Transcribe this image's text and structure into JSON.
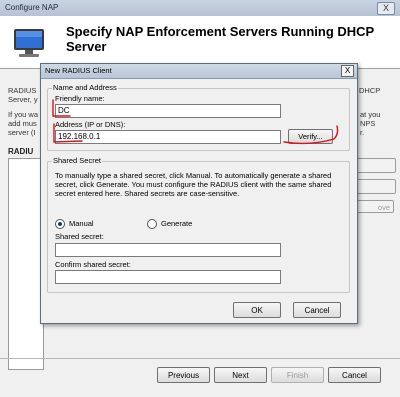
{
  "outer_window": {
    "title": "Configure NAP",
    "close_glyph": "X",
    "heading": "Specify NAP Enforcement Servers Running DHCP Server",
    "icon": "computer-monitor-icon",
    "bg_fragments": {
      "left_1": "RADIUS",
      "left_2": "Server, y",
      "right_1": "DHCP",
      "left_3": "If you wa",
      "left_4": "add mus",
      "left_5": "server (I",
      "right_2": "at you",
      "right_3": "NPS",
      "right_4": "r.",
      "list_heading": "RADIU",
      "side_btn_2": "",
      "side_btn_3": "ove"
    },
    "buttons": {
      "previous": "Previous",
      "next": "Next",
      "finish": "Finish",
      "cancel": "Cancel"
    }
  },
  "dialog": {
    "title": "New RADIUS Client",
    "close_glyph": "X",
    "name_group": {
      "label": "Name and Address",
      "friendly_name_label": "Friendly name:",
      "friendly_name_value": "DC",
      "address_label": "Address (IP or DNS):",
      "address_value": "192.168.0.1",
      "verify_label": "Verify..."
    },
    "secret_group": {
      "label": "Shared Secret",
      "description": "To manually type a shared secret, click Manual. To automatically generate a shared secret, click Generate. You must configure the RADIUS client with the same shared secret entered here. Shared secrets are case-sensitive.",
      "manual_label": "Manual",
      "generate_label": "Generate",
      "selected": "Manual",
      "shared_secret_label": "Shared secret:",
      "shared_secret_value": "",
      "confirm_label": "Confirm shared secret:",
      "confirm_value": ""
    },
    "ok_label": "OK",
    "cancel_label": "Cancel"
  },
  "colors": {
    "annotation_red": "#e0101a",
    "window_bg": "#f0f0f0"
  }
}
